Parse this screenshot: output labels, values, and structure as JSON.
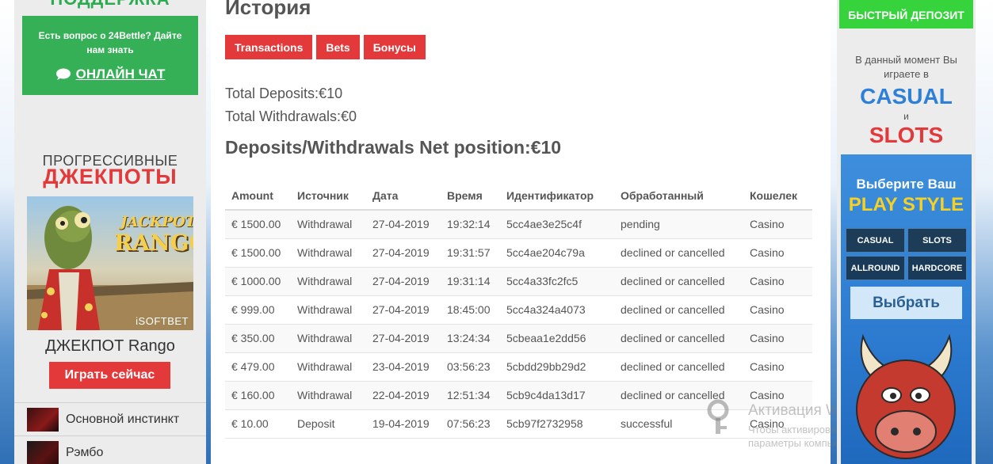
{
  "left": {
    "support_title": "ПОДДЕРЖКА",
    "support_text": "Есть вопрос о 24Bettle? Дайте нам знать",
    "chat_label": "ОНЛАЙН ЧАТ",
    "jackpot_title_1": "ПРОГРЕССИВНЫЕ",
    "jackpot_title_2": "ДЖЕКПОТЫ",
    "jackpot_logo_1": "JACKPOT",
    "jackpot_logo_2": "RANGO",
    "jackpot_brand": "iSOFTBET",
    "jackpot_name": "ДЖЕКПОТ Rango",
    "play_label": "Играть сейчас",
    "games": [
      "Основной инстинкт",
      "Рэмбо"
    ]
  },
  "main": {
    "title": "История",
    "tabs": [
      "Transactions",
      "Bets",
      "Бонусы"
    ],
    "total_deposits": "Total Deposits:€10",
    "total_withdrawals": "Total Withdrawals:€0",
    "net_position": "Deposits/Withdrawals Net position:€10",
    "columns": [
      "Amount",
      "Источник",
      "Дата",
      "Время",
      "Идентификатор",
      "Обработанный",
      "Кошелек"
    ],
    "rows": [
      [
        "€ 1500.00",
        "Withdrawal",
        "27-04-2019",
        "19:32:14",
        "5cc4ae3e25c4f",
        "pending",
        "Casino"
      ],
      [
        "€ 1500.00",
        "Withdrawal",
        "27-04-2019",
        "19:31:57",
        "5cc4ae204c79a",
        "declined or cancelled",
        "Casino"
      ],
      [
        "€ 1000.00",
        "Withdrawal",
        "27-04-2019",
        "19:31:14",
        "5cc4a33fc2fc5",
        "declined or cancelled",
        "Casino"
      ],
      [
        "€ 999.00",
        "Withdrawal",
        "27-04-2019",
        "18:45:00",
        "5cc4a324a4073",
        "declined or cancelled",
        "Casino"
      ],
      [
        "€ 350.00",
        "Withdrawal",
        "27-04-2019",
        "13:24:34",
        "5cbeaa1e2dd56",
        "declined or cancelled",
        "Casino"
      ],
      [
        "€ 479.00",
        "Withdrawal",
        "23-04-2019",
        "03:56:23",
        "5cbdd29bb29d2",
        "declined or cancelled",
        "Casino"
      ],
      [
        "€ 160.00",
        "Withdrawal",
        "22-04-2019",
        "12:51:34",
        "5cb9c4da13d17",
        "declined or cancelled",
        "Casino"
      ],
      [
        "€ 10.00",
        "Deposit",
        "19-04-2019",
        "07:56:23",
        "5cb97f2732958",
        "successful",
        "Casino"
      ]
    ],
    "watermark_title": "Активация Windows",
    "watermark_sub": "Чтобы активировать Windows, перейдите в параметры компьютера."
  },
  "right": {
    "fast_deposit": "БЫСТРЫЙ ДЕПОЗИТ",
    "now_playing": "В данный момент Вы играете в",
    "casual": "CASUAL",
    "conj": "и",
    "slots": "SLOTS",
    "choose_1": "Выберите Ваш",
    "choose_2": "PLAY STYLE",
    "styles": [
      "CASUAL",
      "SLOTS",
      "ALLROUND",
      "HARDCORE"
    ],
    "select_label": "Выбрать"
  },
  "colors": {
    "accent_red": "#e4393a",
    "support_green": "#36b057",
    "deposit_green": "#36d33c",
    "casual_blue": "#2d7fd8",
    "playstyle_yellow": "#f6d125"
  }
}
